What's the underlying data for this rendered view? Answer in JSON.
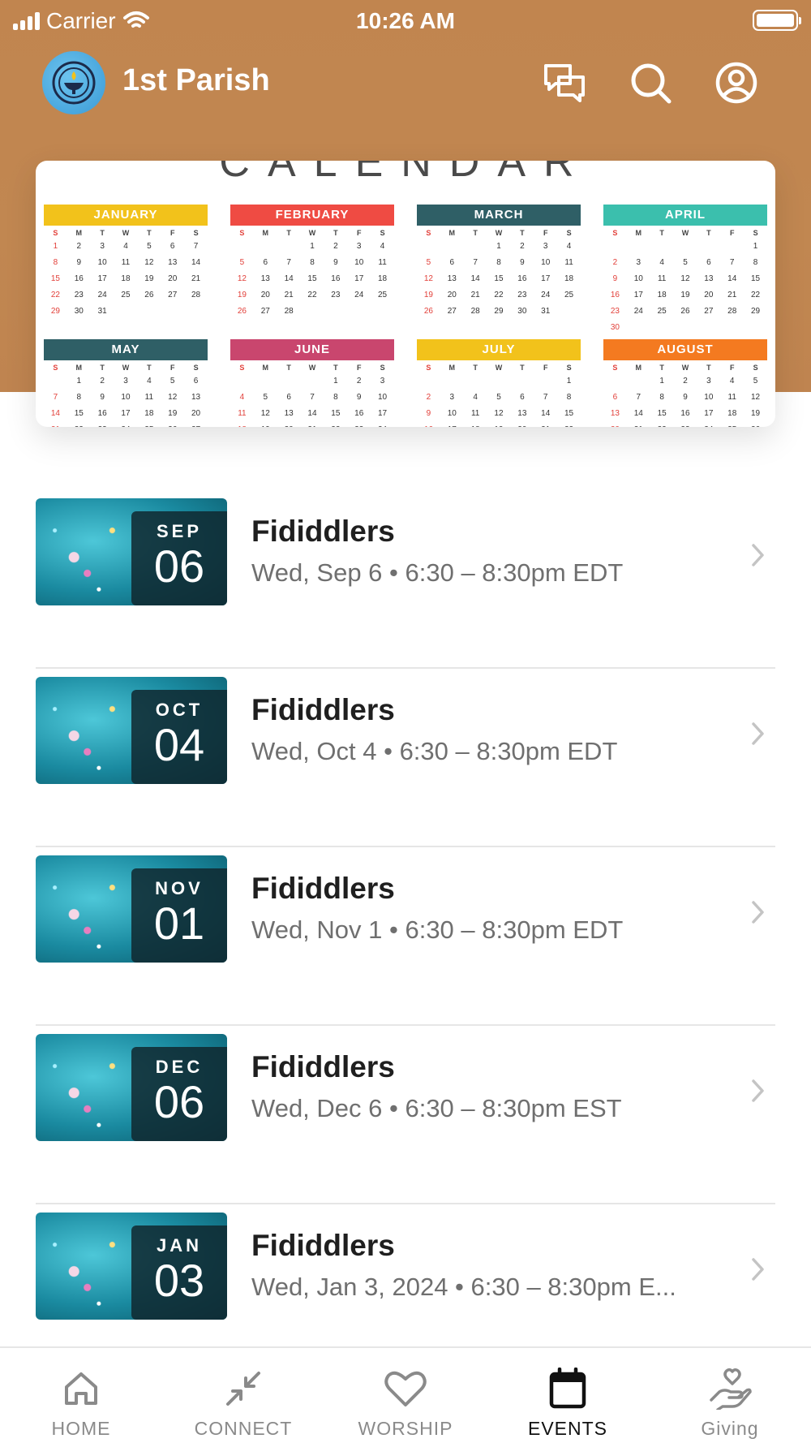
{
  "status_bar": {
    "carrier": "Carrier",
    "time": "10:26 AM"
  },
  "app_bar": {
    "title": "1st Parish",
    "icons": [
      "chat-icon",
      "search-icon",
      "profile-icon"
    ]
  },
  "hero": {
    "title": "CALENDAR",
    "months": [
      {
        "name": "JANUARY",
        "color": "#f2c21b",
        "rows": [
          [
            "",
            "1",
            "2",
            "3",
            "4",
            "5",
            "6",
            "7"
          ]
        ]
      },
      {
        "name": "FEBRUARY",
        "color": "#ef4b43"
      },
      {
        "name": "MARCH",
        "color": "#2f5f66"
      },
      {
        "name": "APRIL",
        "color": "#3bbfad"
      },
      {
        "name": "MAY",
        "color": "#2f5f66"
      },
      {
        "name": "JUNE",
        "color": "#c9466e"
      },
      {
        "name": "JULY",
        "color": "#f2c21b"
      },
      {
        "name": "AUGUST",
        "color": "#f47a20"
      }
    ],
    "weekday_letters": [
      "S",
      "M",
      "T",
      "W",
      "T",
      "F",
      "S"
    ]
  },
  "events": [
    {
      "month": "SEP",
      "day": "06",
      "title": "Fididdlers",
      "subtitle": "Wed, Sep 6 • 6:30 – 8:30pm EDT"
    },
    {
      "month": "OCT",
      "day": "04",
      "title": "Fididdlers",
      "subtitle": "Wed, Oct 4 • 6:30 – 8:30pm EDT"
    },
    {
      "month": "NOV",
      "day": "01",
      "title": "Fididdlers",
      "subtitle": "Wed, Nov 1 • 6:30 – 8:30pm EDT"
    },
    {
      "month": "DEC",
      "day": "06",
      "title": "Fididdlers",
      "subtitle": "Wed, Dec 6 • 6:30 – 8:30pm EST"
    },
    {
      "month": "JAN",
      "day": "03",
      "title": "Fididdlers",
      "subtitle": "Wed, Jan 3, 2024 • 6:30 – 8:30pm E..."
    }
  ],
  "tab_bar": {
    "tabs": [
      {
        "label": "HOME",
        "icon": "home-icon"
      },
      {
        "label": "CONNECT",
        "icon": "connect-icon"
      },
      {
        "label": "WORSHIP",
        "icon": "heart-icon"
      },
      {
        "label": "EVENTS",
        "icon": "calendar-icon"
      },
      {
        "label": "Giving",
        "icon": "giving-icon"
      }
    ],
    "active": "EVENTS"
  },
  "colors": {
    "header": "#c1854f",
    "accent_text": "#ffffff",
    "active_tab": "#111111",
    "inactive_tab": "#8a8a8a"
  }
}
